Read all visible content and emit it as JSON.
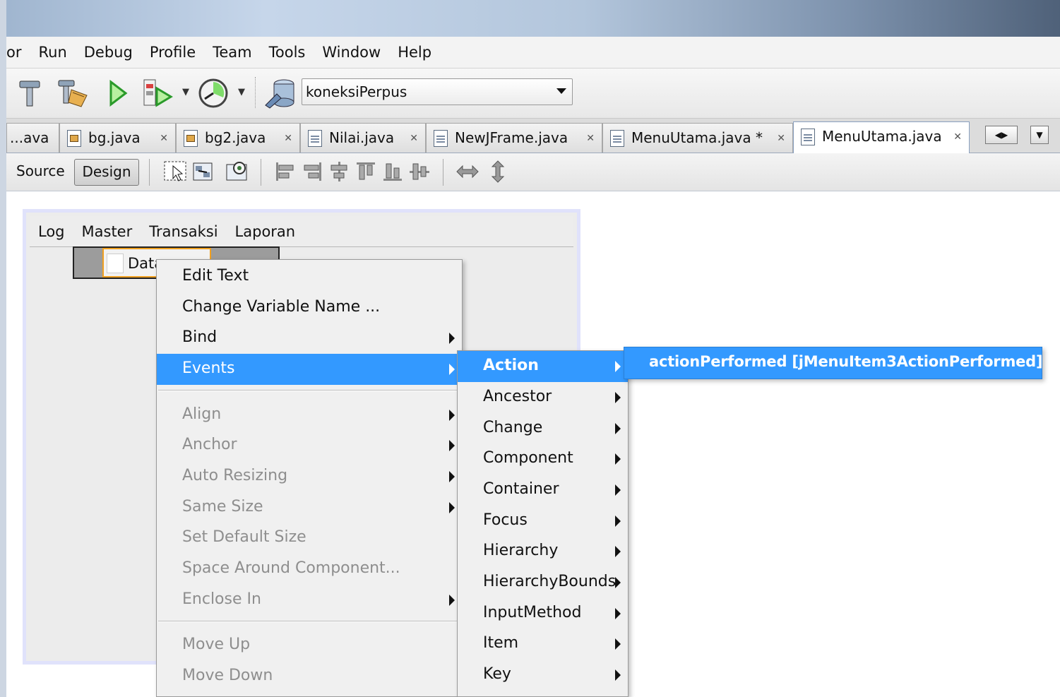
{
  "menubar": [
    "or",
    "Run",
    "Debug",
    "Profile",
    "Team",
    "Tools",
    "Window",
    "Help"
  ],
  "toolbar": {
    "config_value": "koneksiPerpus"
  },
  "tabs": [
    {
      "label": "...ava",
      "active": false
    },
    {
      "label": "bg.java",
      "active": false
    },
    {
      "label": "bg2.java",
      "active": false
    },
    {
      "label": "Nilai.java",
      "active": false
    },
    {
      "label": "NewJFrame.java",
      "active": false
    },
    {
      "label": "MenuUtama.java *",
      "active": false
    },
    {
      "label": "MenuUtama.java",
      "active": true
    }
  ],
  "editor_toolbar": {
    "source_label": "Source",
    "design_label": "Design"
  },
  "form": {
    "menus": [
      "Log",
      "Master",
      "Transaksi",
      "Laporan"
    ],
    "submenu_item_label": "Data"
  },
  "context_menu": {
    "items": [
      {
        "label": "Edit Text"
      },
      {
        "label": "Change Variable Name ..."
      },
      {
        "label": "Bind"
      },
      {
        "label": "Events"
      },
      {
        "label": "Align"
      },
      {
        "label": "Anchor"
      },
      {
        "label": "Auto Resizing"
      },
      {
        "label": "Same Size"
      },
      {
        "label": "Set Default Size"
      },
      {
        "label": "Space Around Component..."
      },
      {
        "label": "Enclose In"
      },
      {
        "label": "Move Up"
      },
      {
        "label": "Move Down"
      }
    ]
  },
  "events_menu": {
    "items": [
      {
        "label": "Action"
      },
      {
        "label": "Ancestor"
      },
      {
        "label": "Change"
      },
      {
        "label": "Component"
      },
      {
        "label": "Container"
      },
      {
        "label": "Focus"
      },
      {
        "label": "Hierarchy"
      },
      {
        "label": "HierarchyBounds"
      },
      {
        "label": "InputMethod"
      },
      {
        "label": "Item"
      },
      {
        "label": "Key"
      }
    ]
  },
  "action_menu": {
    "item_label": "actionPerformed [jMenuItem3ActionPerformed]"
  }
}
